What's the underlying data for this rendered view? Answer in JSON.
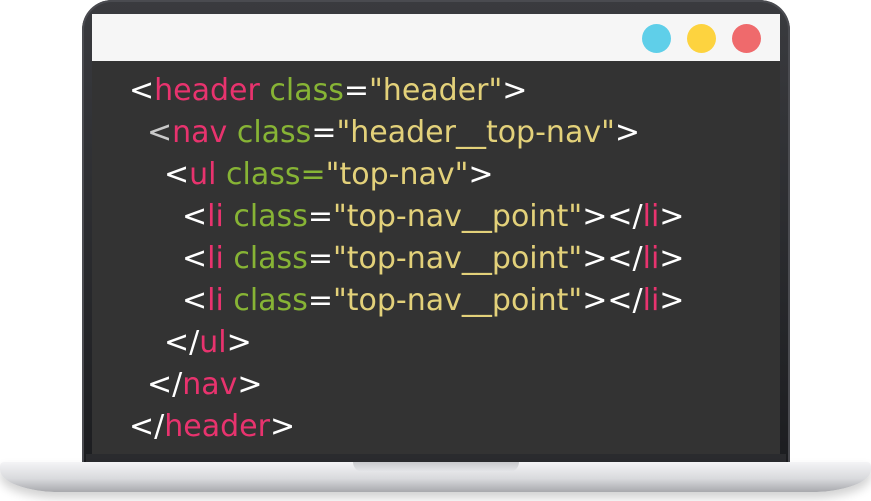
{
  "colors": {
    "window_background": "#333333",
    "titlebar_background": "#f6f6f6",
    "bracket": "#ffffff",
    "bracket_dim": "#c9c9c9",
    "tag": "#e8336e",
    "attribute": "#87b435",
    "string": "#e3d17a",
    "dot_blue": "#5fcfe9",
    "dot_yellow": "#fdd33f",
    "dot_red": "#ef6a6c"
  },
  "window_controls": [
    {
      "icon": "blue-circle-icon",
      "color": "#5fcfe9"
    },
    {
      "icon": "yellow-circle-icon",
      "color": "#fdd33f"
    },
    {
      "icon": "red-circle-icon",
      "color": "#ef6a6c"
    }
  ],
  "code": {
    "lines": [
      {
        "tokens": [
          {
            "text": "<",
            "kind": "bracket"
          },
          {
            "text": "header",
            "kind": "tag"
          },
          {
            "text": " class",
            "kind": "attribute"
          },
          {
            "text": "=",
            "kind": "bracket"
          },
          {
            "text": "\"header\"",
            "kind": "string"
          },
          {
            "text": ">",
            "kind": "bracket"
          }
        ]
      },
      {
        "tokens": [
          {
            "text": "<",
            "kind": "bracket_dim"
          },
          {
            "text": "nav",
            "kind": "tag"
          },
          {
            "text": " class",
            "kind": "attribute"
          },
          {
            "text": "=",
            "kind": "bracket"
          },
          {
            "text": "\"header__top-nav\"",
            "kind": "string"
          },
          {
            "text": ">",
            "kind": "bracket"
          }
        ]
      },
      {
        "tokens": [
          {
            "text": "<",
            "kind": "bracket"
          },
          {
            "text": "ul",
            "kind": "tag"
          },
          {
            "text": " class",
            "kind": "attribute"
          },
          {
            "text": "=",
            "kind": "attribute"
          },
          {
            "text": "\"top-nav\"",
            "kind": "string"
          },
          {
            "text": ">",
            "kind": "bracket"
          }
        ]
      },
      {
        "tokens": [
          {
            "text": "<",
            "kind": "bracket"
          },
          {
            "text": "li",
            "kind": "tag"
          },
          {
            "text": " class",
            "kind": "attribute"
          },
          {
            "text": "=",
            "kind": "bracket"
          },
          {
            "text": "\"top-nav__point\"",
            "kind": "string"
          },
          {
            "text": "></",
            "kind": "bracket"
          },
          {
            "text": "li",
            "kind": "tag"
          },
          {
            "text": ">",
            "kind": "bracket"
          }
        ]
      },
      {
        "tokens": [
          {
            "text": "<",
            "kind": "bracket"
          },
          {
            "text": "li",
            "kind": "tag"
          },
          {
            "text": " class",
            "kind": "attribute"
          },
          {
            "text": "=",
            "kind": "bracket"
          },
          {
            "text": "\"top-nav__point\"",
            "kind": "string"
          },
          {
            "text": "></",
            "kind": "bracket"
          },
          {
            "text": "li",
            "kind": "tag"
          },
          {
            "text": ">",
            "kind": "bracket"
          }
        ]
      },
      {
        "tokens": [
          {
            "text": "<",
            "kind": "bracket"
          },
          {
            "text": "li",
            "kind": "tag"
          },
          {
            "text": " class",
            "kind": "attribute"
          },
          {
            "text": "=",
            "kind": "bracket"
          },
          {
            "text": "\"top-nav__point\"",
            "kind": "string"
          },
          {
            "text": "></",
            "kind": "bracket"
          },
          {
            "text": "li",
            "kind": "tag"
          },
          {
            "text": ">",
            "kind": "bracket"
          }
        ]
      },
      {
        "tokens": [
          {
            "text": "</",
            "kind": "bracket"
          },
          {
            "text": "ul",
            "kind": "tag"
          },
          {
            "text": ">",
            "kind": "bracket"
          }
        ]
      },
      {
        "tokens": [
          {
            "text": "</",
            "kind": "bracket"
          },
          {
            "text": "nav",
            "kind": "tag"
          },
          {
            "text": ">",
            "kind": "bracket"
          }
        ]
      },
      {
        "tokens": [
          {
            "text": "</",
            "kind": "bracket"
          },
          {
            "text": "header",
            "kind": "tag"
          },
          {
            "text": ">",
            "kind": "bracket"
          }
        ]
      }
    ]
  }
}
